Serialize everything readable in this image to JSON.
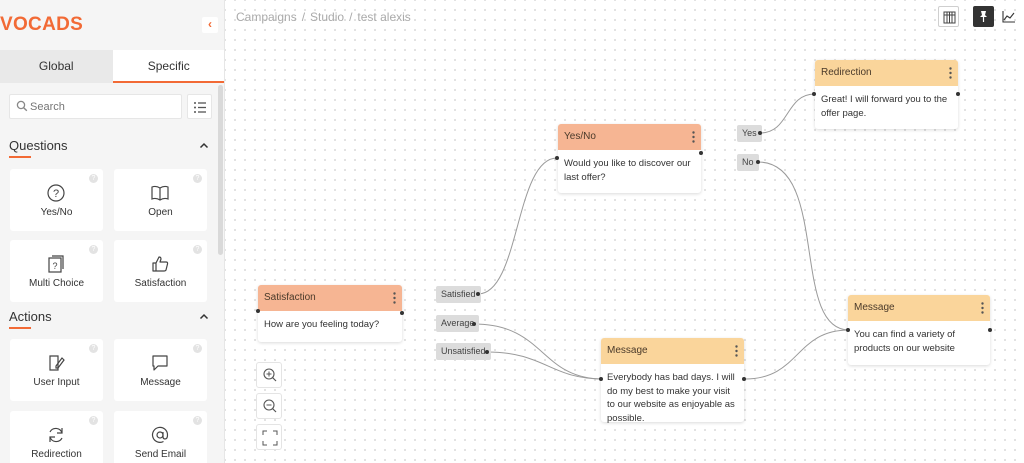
{
  "app": {
    "logo": "VOCADS",
    "collapse_icon": "chevron-left-icon"
  },
  "sidebar": {
    "tabs": [
      {
        "label": "Global"
      },
      {
        "label": "Specific"
      }
    ],
    "search": {
      "placeholder": "Search",
      "value": ""
    },
    "sections": [
      {
        "title": "Questions",
        "items": [
          {
            "label": "Yes/No",
            "icon": "question-circle-icon"
          },
          {
            "label": "Open",
            "icon": "open-book-icon"
          },
          {
            "label": "Multi Choice",
            "icon": "multi-choice-icon"
          },
          {
            "label": "Satisfaction",
            "icon": "thumbs-up-icon"
          }
        ]
      },
      {
        "title": "Actions",
        "items": [
          {
            "label": "User Input",
            "icon": "edit-document-icon"
          },
          {
            "label": "Message",
            "icon": "chat-bubble-icon"
          },
          {
            "label": "Redirection",
            "icon": "refresh-icon"
          },
          {
            "label": "Send Email",
            "icon": "at-sign-icon"
          }
        ]
      }
    ]
  },
  "breadcrumb": [
    "Campaigns",
    "Studio",
    "test alexis"
  ],
  "breadcrumb_separator": "/",
  "nodes": {
    "satisfaction": {
      "title": "Satisfaction",
      "text": "How are you feeling today?",
      "answers": [
        "Satisfied",
        "Average",
        "Unsatisfied"
      ]
    },
    "yesno": {
      "title": "Yes/No",
      "text": "Would you like to discover our last offer?",
      "answers": [
        "Yes",
        "No"
      ]
    },
    "redirection": {
      "title": "Redirection",
      "text": "Great! I will forward you to the offer page."
    },
    "message_right": {
      "title": "Message",
      "text": "You can find a variety of products on our website"
    },
    "message_bottom": {
      "title": "Message",
      "text": "Everybody has bad days. I will do my best to make your visit to our website as enjoyable as possible."
    }
  },
  "colors": {
    "accent": "#f26a35",
    "question_header": "#f6b593",
    "action_header": "#fad59b"
  }
}
